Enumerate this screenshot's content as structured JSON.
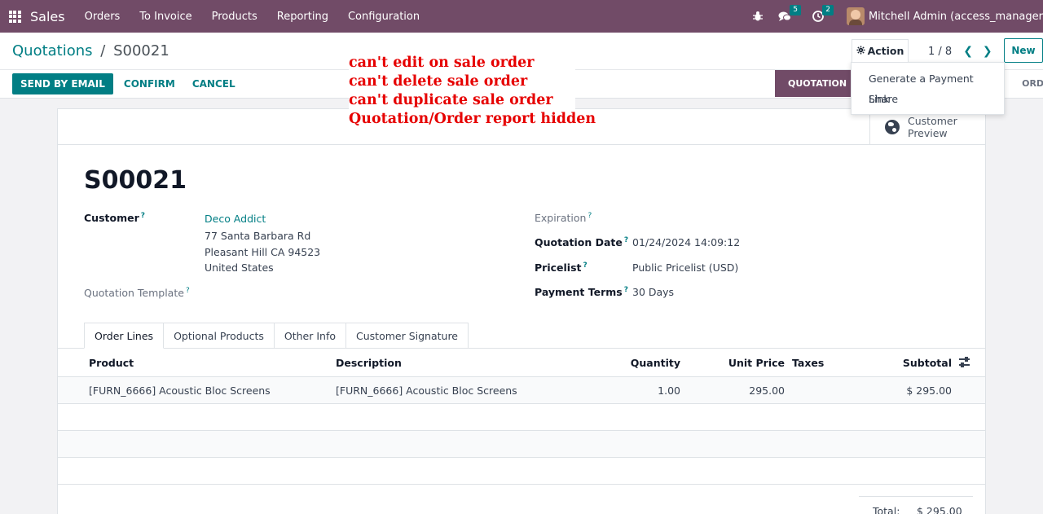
{
  "navbar": {
    "brand": "Sales",
    "menu": [
      "Orders",
      "To Invoice",
      "Products",
      "Reporting",
      "Configuration"
    ],
    "chat_count": "5",
    "activity_count": "2",
    "user": "Mitchell Admin (access_manager"
  },
  "breadcrumb": {
    "parent": "Quotations",
    "separator": "/",
    "current": "S00021"
  },
  "buttons": {
    "send_email": "SEND BY EMAIL",
    "confirm": "CONFIRM",
    "cancel": "CANCEL"
  },
  "status": {
    "active": "QUOTATION",
    "next": "ORDER"
  },
  "action": {
    "label": "Action",
    "items": [
      "Generate a Payment Link",
      "Share"
    ]
  },
  "pager": {
    "value": "1 / 8"
  },
  "new_label": "New",
  "smart_button": {
    "line1": "Customer",
    "line2": "Preview"
  },
  "record": {
    "name": "S00021",
    "customer_label": "Customer",
    "customer_name": "Deco Addict",
    "address": [
      "77 Santa Barbara Rd",
      "Pleasant Hill CA 94523",
      "United States"
    ],
    "template_label": "Quotation Template",
    "expiration_label": "Expiration",
    "quotation_date_label": "Quotation Date",
    "quotation_date": "01/24/2024 14:09:12",
    "pricelist_label": "Pricelist",
    "pricelist": "Public Pricelist (USD)",
    "payment_terms_label": "Payment Terms",
    "payment_terms": "30 Days"
  },
  "tabs": [
    "Order Lines",
    "Optional Products",
    "Other Info",
    "Customer Signature"
  ],
  "table": {
    "headers": [
      "Product",
      "Description",
      "Quantity",
      "Unit Price",
      "Taxes",
      "Subtotal"
    ],
    "rows": [
      {
        "product": "[FURN_6666] Acoustic Bloc Screens",
        "description": "[FURN_6666] Acoustic Bloc Screens",
        "quantity": "1.00",
        "unit_price": "295.00",
        "taxes": "",
        "subtotal": "$ 295.00"
      }
    ]
  },
  "totals": {
    "label": "Total:",
    "value": "$ 295.00"
  },
  "annotation": [
    "can't edit on sale order",
    "can't delete sale order",
    "can't duplicate sale order",
    "Quotation/Order report hidden"
  ],
  "icons": [
    "apps-grid-icon",
    "bug-icon",
    "chat-icon",
    "clock-icon",
    "gear-icon",
    "chevron-left-icon",
    "chevron-right-icon",
    "globe-icon",
    "column-settings-icon"
  ]
}
